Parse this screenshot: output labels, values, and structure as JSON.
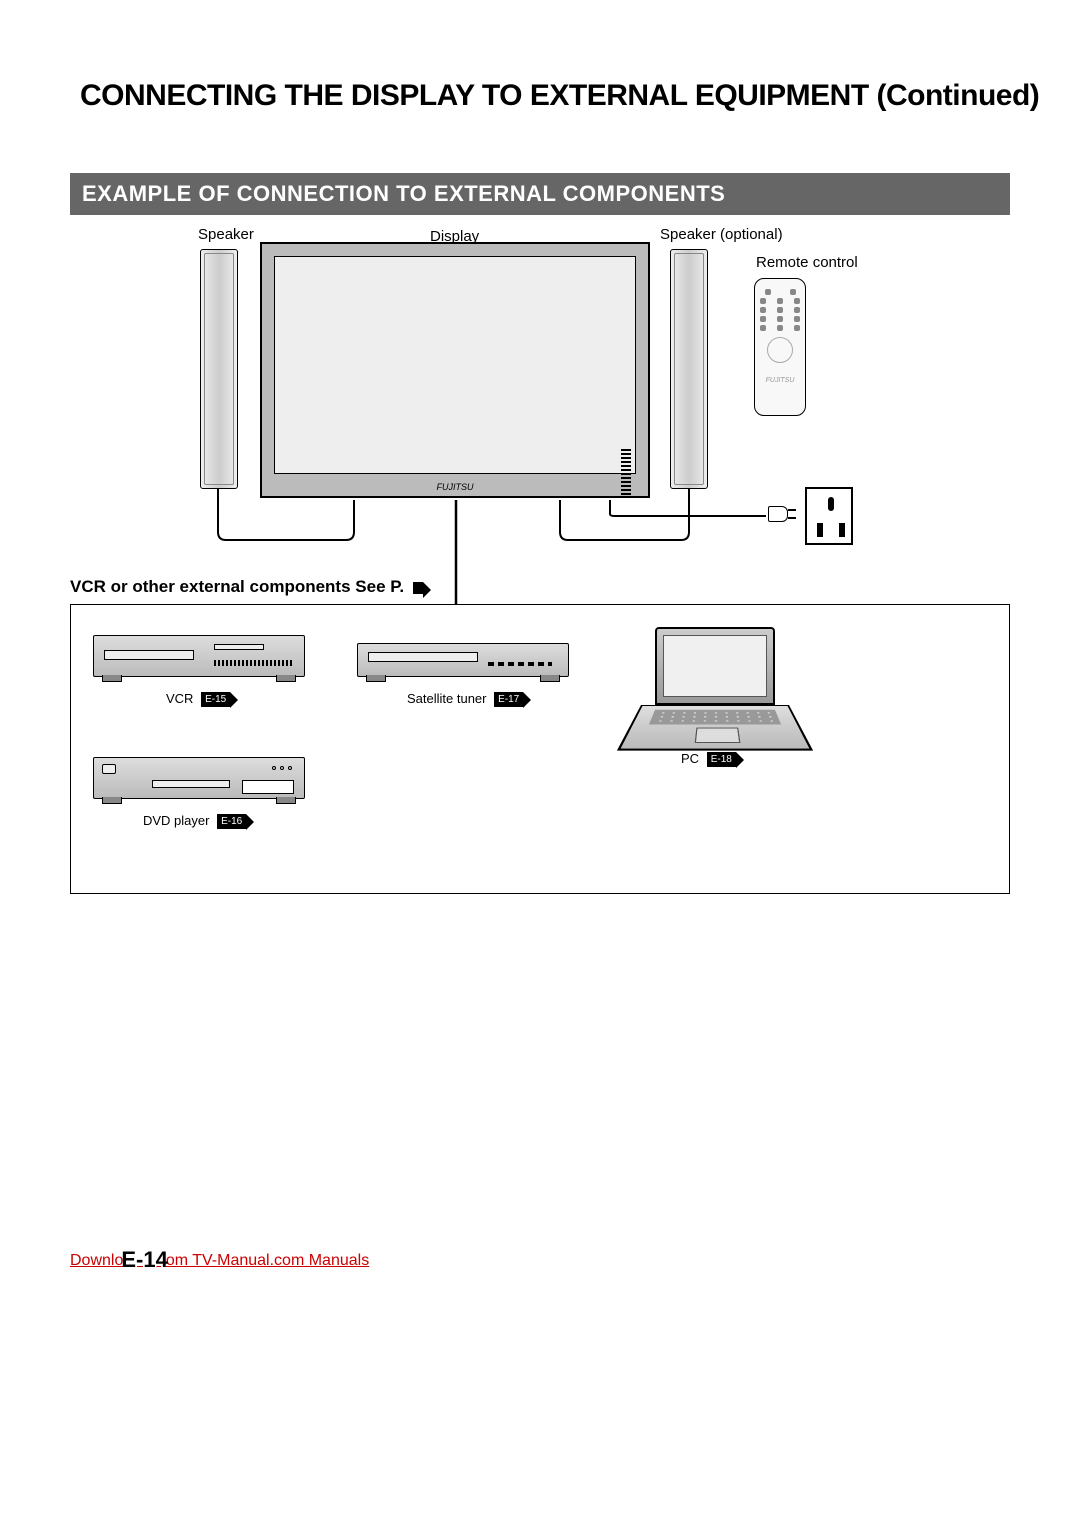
{
  "title": "CONNECTING THE DISPLAY TO EXTERNAL EQUIPMENT (Continued)",
  "section_heading": "EXAMPLE OF CONNECTION TO EXTERNAL COMPONENTS",
  "labels": {
    "speaker": "Speaker",
    "display": "Display",
    "speaker_optional": "Speaker (optional)",
    "remote": "Remote control",
    "brand": "FUJITSU"
  },
  "vcr_heading": "VCR or other external components See P.",
  "devices": {
    "vcr": {
      "name": "VCR",
      "page": "E-15"
    },
    "dvd": {
      "name": "DVD player",
      "page": "E-16"
    },
    "sat": {
      "name": "Satellite tuner",
      "page": "E-17"
    },
    "pc": {
      "name": "PC",
      "page": "E-18"
    }
  },
  "footer": {
    "prefix": "Downlo",
    "pagenum": "E-14",
    "suffix": "om TV-Manual.com Manuals"
  }
}
